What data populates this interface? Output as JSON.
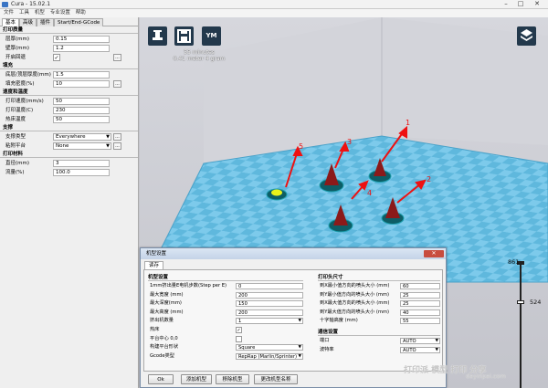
{
  "window": {
    "title": "Cura - 15.02.1"
  },
  "menubar": [
    "文件",
    "工具",
    "机型",
    "专业设置",
    "帮助"
  ],
  "left_tabs": [
    "基本",
    "高级",
    "插件",
    "Start/End-GCode"
  ],
  "sections": [
    {
      "title": "打印质量",
      "rows": [
        {
          "label": "层厚(mm)",
          "value": "0.15",
          "type": "input"
        },
        {
          "label": "壁厚(mm)",
          "value": "1.2",
          "type": "input"
        },
        {
          "label": "开启回退",
          "value": "✓",
          "type": "checkbox",
          "dots": "..."
        }
      ]
    },
    {
      "title": "填充",
      "rows": [
        {
          "label": "底层/顶层厚度(mm)",
          "value": "1.5",
          "type": "input"
        },
        {
          "label": "填充密度(%)",
          "value": "10",
          "type": "input",
          "dots": "..."
        }
      ]
    },
    {
      "title": "速度和温度",
      "rows": [
        {
          "label": "打印速度(mm/s)",
          "value": "50",
          "type": "input"
        },
        {
          "label": "打印温度(C)",
          "value": "230",
          "type": "input"
        },
        {
          "label": "热床温度",
          "value": "50",
          "type": "input"
        }
      ]
    },
    {
      "title": "支撑",
      "rows": [
        {
          "label": "支撑类型",
          "value": "Everywhere",
          "type": "select",
          "dots": "..."
        },
        {
          "label": "粘附平台",
          "value": "None",
          "type": "select",
          "dots": "..."
        }
      ]
    },
    {
      "title": "打印材料",
      "rows": [
        {
          "label": "直径(mm)",
          "value": "3",
          "type": "input"
        },
        {
          "label": "流量(%)",
          "value": "100.0",
          "type": "input"
        }
      ]
    }
  ],
  "viewport": {
    "buttons": [
      {
        "name": "load-model-button",
        "label": "load"
      },
      {
        "name": "save-gcode-button",
        "label": "save"
      },
      {
        "name": "ym-button",
        "label": "YM"
      }
    ],
    "print_time": "55 minutes",
    "print_material": "0.41 meter 4 gram",
    "annotations": [
      "1",
      "2",
      "3",
      "4",
      "5"
    ],
    "colors": {
      "plate": "#5fb8dd",
      "cone": "#8b1a1a",
      "arrow": "#ee1111"
    }
  },
  "dialog": {
    "title": "机型设置",
    "tab": "读存",
    "left_section": "机型设置",
    "left_rows": [
      {
        "label": "1mm挤出量E电机步数(Step per E)",
        "value": "0",
        "type": "input"
      },
      {
        "label": "最大宽度 (mm)",
        "value": "200",
        "type": "input"
      },
      {
        "label": "最大深度(mm)",
        "value": "150",
        "type": "input"
      },
      {
        "label": "最大高度 (mm)",
        "value": "200",
        "type": "input"
      },
      {
        "label": "挤出机数量",
        "value": "1",
        "type": "select"
      },
      {
        "label": "热床",
        "value": "✓",
        "type": "checkbox"
      },
      {
        "label": "平台中心 0,0",
        "value": "",
        "type": "checkbox"
      },
      {
        "label": "构建平台形状",
        "value": "Square",
        "type": "select"
      },
      {
        "label": "Gcode类型",
        "value": "RepRap (Marlin/Sprinter)",
        "type": "select"
      }
    ],
    "right_section": "打印头尺寸",
    "right_rows": [
      {
        "label": "到X最小值方向的喷头大小 (mm)",
        "value": "60"
      },
      {
        "label": "到Y最小值方向的喷头大小 (mm)",
        "value": "25"
      },
      {
        "label": "到X最大值方向的喷头大小 (mm)",
        "value": "25"
      },
      {
        "label": "到Y最大值方向的喷头大小 (mm)",
        "value": "40"
      },
      {
        "label": "十字轴高度 (mm)",
        "value": "55"
      }
    ],
    "comm_section": "通信设置",
    "comm_rows": [
      {
        "label": "端口",
        "value": "AUTO"
      },
      {
        "label": "波特率",
        "value": "AUTO"
      }
    ],
    "buttons": [
      "Ok",
      "添加机型",
      "移除机型",
      "更改机型名称"
    ]
  },
  "slider": {
    "top": "861",
    "mid": "524"
  },
  "watermark": {
    "text": "打印派 模型 打印 分享",
    "url": "dayinpai.com"
  }
}
